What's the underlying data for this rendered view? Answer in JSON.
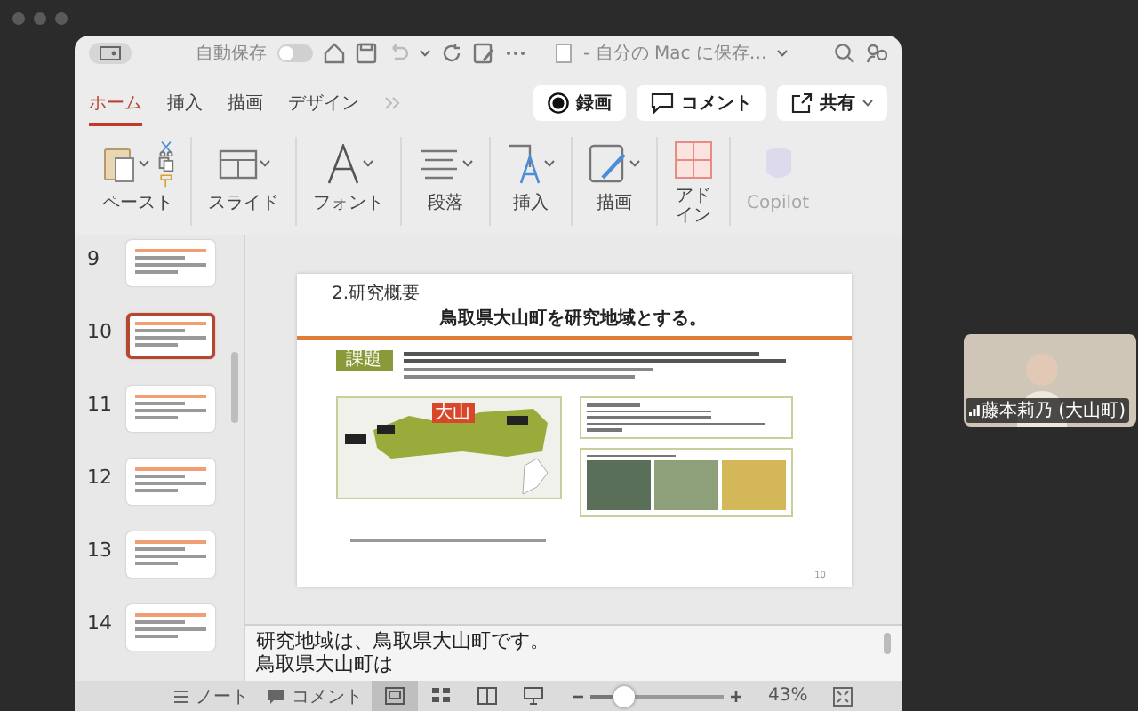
{
  "titlebar": {
    "autosave_label": "自動保存",
    "autosave_on": false,
    "doc_title": "- 自分の Mac に保存…"
  },
  "tabs": [
    {
      "label": "ホーム",
      "selected": true
    },
    {
      "label": "挿入",
      "selected": false
    },
    {
      "label": "描画",
      "selected": false
    },
    {
      "label": "デザイン",
      "selected": false
    }
  ],
  "actions": [
    {
      "kind": "record",
      "label": "録画"
    },
    {
      "kind": "comment",
      "label": "コメント"
    },
    {
      "kind": "share",
      "label": "共有"
    }
  ],
  "ribbon": [
    {
      "kind": "paste",
      "label": "ペースト",
      "disabled": false
    },
    {
      "kind": "slide",
      "label": "スライド",
      "disabled": false
    },
    {
      "kind": "font",
      "label": "フォント",
      "disabled": false
    },
    {
      "kind": "paragraph",
      "label": "段落",
      "disabled": false
    },
    {
      "kind": "insert",
      "label": "挿入",
      "disabled": false
    },
    {
      "kind": "draw",
      "label": "描画",
      "disabled": false
    },
    {
      "kind": "addin",
      "label": "アドイン",
      "disabled": false
    },
    {
      "kind": "copilot",
      "label": "Copilot",
      "disabled": true
    }
  ],
  "thumbnails": [
    {
      "number": "9",
      "selected": false
    },
    {
      "number": "10",
      "selected": true
    },
    {
      "number": "11",
      "selected": false
    },
    {
      "number": "12",
      "selected": false
    },
    {
      "number": "13",
      "selected": false
    },
    {
      "number": "14",
      "selected": false
    }
  ],
  "slide": {
    "section": "2.研究概要",
    "title": "鳥取県大山町を研究地域とする。",
    "tag": "課題",
    "map_label": "大山",
    "page": "10"
  },
  "notes": {
    "lines": [
      "研究地域は、鳥取県大山町です。",
      "鳥取県大山町は"
    ]
  },
  "status_bar": {
    "notes_label": "ノート",
    "comment_label": "コメント",
    "views": [
      {
        "kind": "normal",
        "selected": true
      },
      {
        "kind": "sorter",
        "selected": false
      },
      {
        "kind": "reading",
        "selected": false
      },
      {
        "kind": "presenter",
        "selected": false
      }
    ],
    "zoom": {
      "level": 0.25,
      "reading": "43%"
    }
  },
  "participant": {
    "name": "藤本莉乃 (大山町)"
  }
}
